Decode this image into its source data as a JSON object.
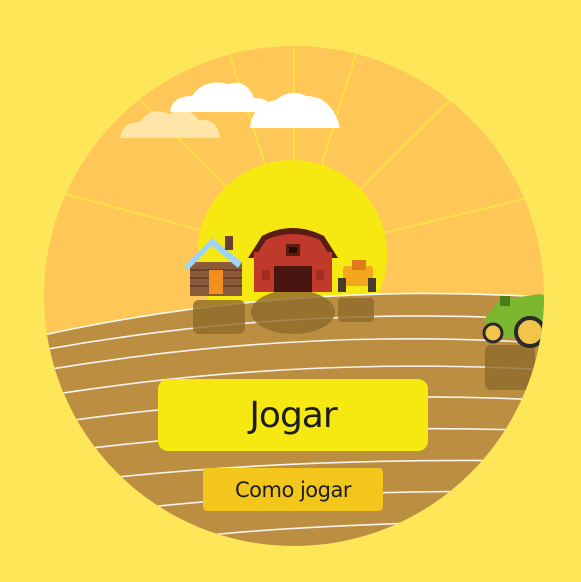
{
  "menu": {
    "play_label": "Jogar",
    "how_to_play_label": "Como jogar"
  },
  "colors": {
    "background": "#fde657",
    "sky": "#fec757",
    "sun": "#f6e912",
    "field": "#bb8e41",
    "play_button": "#f6e912",
    "how_to_button": "#f3c61c",
    "barn": "#c0392b",
    "tractor": "#7cb82f"
  },
  "icons": [
    "cloud-icon",
    "sun-icon",
    "farmhouse-icon",
    "barn-icon",
    "tractor-icon",
    "green-tractor-icon"
  ]
}
